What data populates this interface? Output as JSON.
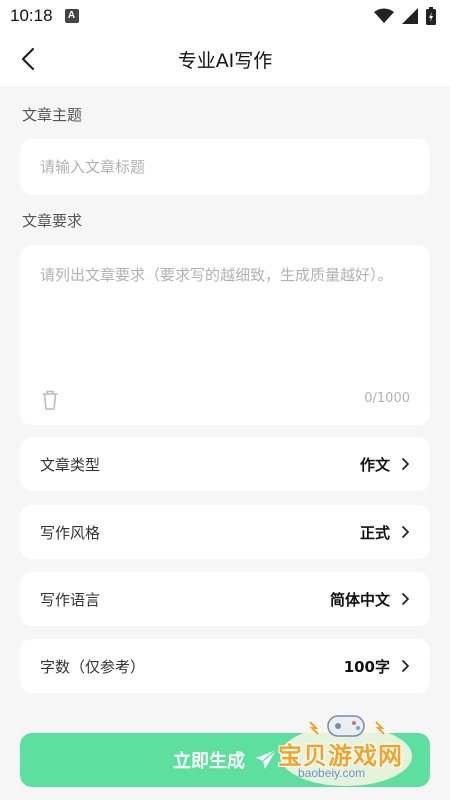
{
  "status_bar": {
    "time": "10:18",
    "notification_letter": "A"
  },
  "header": {
    "title": "专业AI写作"
  },
  "topic": {
    "label": "文章主题",
    "placeholder": "请输入文章标题",
    "value": ""
  },
  "requirements": {
    "label": "文章要求",
    "placeholder": "请列出文章要求（要求写的越细致，生成质量越好）。",
    "value": "",
    "counter": "0/1000"
  },
  "options": [
    {
      "label": "文章类型",
      "value": "作文"
    },
    {
      "label": "写作风格",
      "value": "正式"
    },
    {
      "label": "写作语言",
      "value": "简体中文"
    },
    {
      "label": "字数（仅参考）",
      "value": "100字"
    }
  ],
  "generate_button": {
    "label": "立即生成"
  },
  "watermark": {
    "text": "宝贝游戏网",
    "url": "baobeiy.com"
  },
  "colors": {
    "accent": "#5ddf9f",
    "background": "#f6f6f6",
    "card": "#ffffff",
    "placeholder": "#b2b2b2"
  },
  "icons": [
    "back-arrow-icon",
    "trash-icon",
    "chevron-right-icon",
    "send-icon",
    "wifi-icon",
    "signal-icon",
    "battery-icon"
  ]
}
